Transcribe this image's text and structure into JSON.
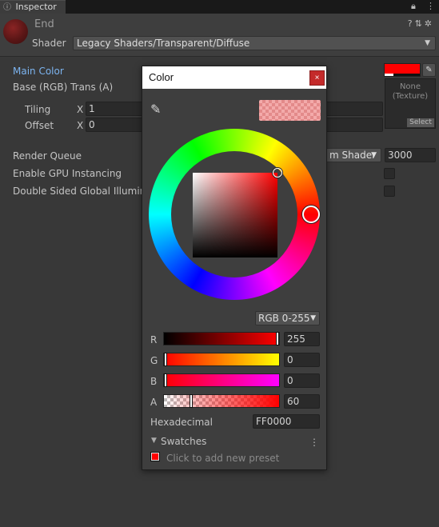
{
  "tab": {
    "icon": "info-icon",
    "label": "Inspector",
    "lock_icon": "lock-icon",
    "menu_icon": "kebab-icon"
  },
  "header": {
    "material_name": "End",
    "icons": [
      "help-icon",
      "preset-icon",
      "gear-icon"
    ],
    "shader_label": "Shader",
    "shader_value": "Legacy Shaders/Transparent/Diffuse"
  },
  "properties": {
    "main_color_label": "Main Color",
    "base_label": "Base (RGB) Trans (A)",
    "main_color_hex": "#ff0000",
    "main_color_alpha": 0.24,
    "tiling_label": "Tiling",
    "tiling_x_label": "X",
    "tiling_x": "1",
    "offset_label": "Offset",
    "offset_x_label": "X",
    "offset_x": "0",
    "texture_none": "None\n(Texture)",
    "texture_select": "Select",
    "render_queue_label": "Render Queue",
    "render_queue_mode": "m Shader",
    "render_queue_value": "3000",
    "gpu_instancing_label": "Enable GPU Instancing",
    "double_sided_label": "Double Sided Global Illumina"
  },
  "color_window": {
    "title": "Color",
    "close_glyph": "×",
    "mode_label": "RGB 0-255",
    "channels": [
      {
        "label": "R",
        "value": "255",
        "fraction": 1.0
      },
      {
        "label": "G",
        "value": "0",
        "fraction": 0.0
      },
      {
        "label": "B",
        "value": "0",
        "fraction": 0.0
      },
      {
        "label": "A",
        "value": "60",
        "fraction": 0.235
      }
    ],
    "hex_label": "Hexadecimal",
    "hex_value": "FF0000",
    "swatches_label": "Swatches",
    "swatch_hint": "Click to add new preset",
    "swatch_color": "#ff0000"
  }
}
